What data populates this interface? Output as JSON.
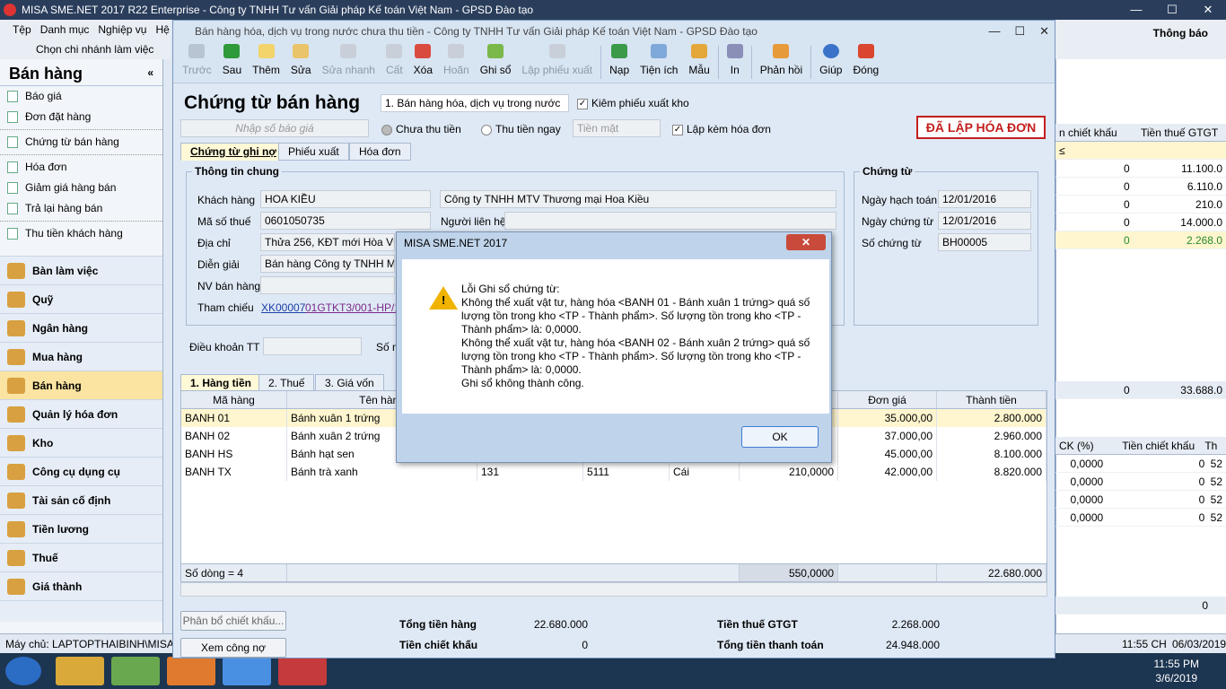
{
  "app": {
    "title": "MISA SME.NET 2017 R22 Enterprise - Công ty TNHH Tư vấn Giải pháp Kế toán Việt Nam - GPSD Đào tạo",
    "notify": "Thông báo"
  },
  "menu": {
    "items": [
      "Tệp",
      "Danh mục",
      "Nghiệp vụ",
      "Hệ"
    ],
    "branch": "Chọn chi nhánh làm việc"
  },
  "sidebar": {
    "title": "Bán hàng",
    "subs": [
      "Báo giá",
      "Đơn đặt hàng",
      "Chứng từ bán hàng",
      "Hóa đơn",
      "Giảm giá hàng bán",
      "Trả lại hàng bán",
      "Thu tiền khách hàng"
    ],
    "modules": [
      "Bàn làm việc",
      "Quỹ",
      "Ngân hàng",
      "Mua hàng",
      "Bán hàng",
      "Quản lý hóa đơn",
      "Kho",
      "Công cụ dụng cụ",
      "Tài sản cố định",
      "Tiền lương",
      "Thuế",
      "Giá thành"
    ]
  },
  "form": {
    "title": "Bán hàng hóa, dịch vụ trong nước chưa thu tiền - Công ty TNHH Tư vấn Giải pháp Kế toán Việt Nam - GPSD Đào tạo",
    "toolbar": [
      "Trước",
      "Sau",
      "Thêm",
      "Sửa",
      "Sửa nhanh",
      "Cất",
      "Xóa",
      "Hoãn",
      "Ghi sổ",
      "Lập phiếu xuất",
      "Nạp",
      "Tiện ích",
      "Mẫu",
      "In",
      "Phản hồi",
      "Giúp",
      "Đóng"
    ],
    "heading": "Chứng từ bán hàng",
    "type": "1. Bán hàng hóa, dịch vụ trong nước",
    "check_export": "Kiêm phiếu xuất kho",
    "quote_placeholder": "Nhập số báo giá",
    "unpaid": "Chưa thu tiền",
    "paid": "Thu tiền ngay",
    "cash": "Tiền mặt",
    "invoice_check": "Lập kèm hóa đơn",
    "badge": "ĐÃ LẬP HÓA ĐƠN",
    "tabs": [
      "Chứng từ ghi nợ",
      "Phiếu xuất",
      "Hóa đơn"
    ],
    "general": "Thông tin chung",
    "customer_lbl": "Khách hàng",
    "customer": "HOA KIỀU",
    "customer_name": "Công ty TNHH MTV Thương mại Hoa Kiều",
    "tax_lbl": "Mã số thuế",
    "tax": "0601050735",
    "contact_lbl": "Người liên hệ",
    "addr_lbl": "Địa chỉ",
    "addr": "Thửa 256, KĐT mới Hòa Vượng",
    "desc_lbl": "Diễn giải",
    "desc": "Bán hàng Công ty TNHH MTV",
    "staff_lbl": "NV bán hàng",
    "ref_lbl": "Tham chiếu",
    "ref1": "XK00007",
    "ref2": "01GTKT3/001-HP/15",
    "voucher": "Chứng từ",
    "acc_date_lbl": "Ngày hạch toán",
    "acc_date": "12/01/2016",
    "doc_date_lbl": "Ngày chứng từ",
    "doc_date": "12/01/2016",
    "doc_no_lbl": "Số chứng từ",
    "doc_no": "BH00005",
    "terms_lbl": "Điều khoản TT",
    "terms_no": "Số n",
    "gtabs": [
      "1. Hàng tiền",
      "2. Thuế",
      "3. Giá vốn"
    ],
    "cols": [
      "Mã hàng",
      "Tên hàng",
      "",
      "",
      "",
      "",
      "Đơn giá",
      "Thành tiền"
    ],
    "rows": [
      [
        "BANH 01",
        "Bánh xuân 1 trứng",
        "",
        "",
        "",
        "",
        "35.000,00",
        "2.800.000"
      ],
      [
        "BANH 02",
        "Bánh xuân 2 trứng",
        "",
        "",
        "",
        "",
        "37.000,00",
        "2.960.000"
      ],
      [
        "BANH HS",
        "Bánh hạt sen",
        "",
        "",
        "",
        "",
        "45.000,00",
        "8.100.000"
      ],
      [
        "BANH TX",
        "Bánh trà xanh",
        "131",
        "5111",
        "Cái",
        "210,0000",
        "42.000,00",
        "8.820.000"
      ]
    ],
    "footer_count": "Số dòng = 4",
    "footer_qty": "550,0000",
    "footer_total": "22.680.000",
    "alloc_btn": "Phân bổ chiết khấu...",
    "view_btn": "Xem công nợ",
    "t1_lbl": "Tổng tiền hàng",
    "t1": "22.680.000",
    "t2_lbl": "Tiền chiết khấu",
    "t2": "0",
    "t3_lbl": "Tiền thuế GTGT",
    "t3": "2.268.000",
    "t4_lbl": "Tổng tiền thanh toán",
    "t4": "24.948.000"
  },
  "right": {
    "h1": "n chiết khấu",
    "h2": "Tiền thuế GTGT",
    "filter": "≤",
    "rows": [
      [
        "0",
        "11.100.0"
      ],
      [
        "0",
        "6.110.0"
      ],
      [
        "0",
        "210.0"
      ],
      [
        "0",
        "14.000.0"
      ],
      [
        "0",
        "2.268.0"
      ]
    ],
    "sum1": "0",
    "sum2": "33.688.0",
    "h3": "CK (%)",
    "h4": "Tiền chiết khấu",
    "h5": "Th",
    "rows2": [
      [
        "0,0000",
        "0",
        "52"
      ],
      [
        "0,0000",
        "0",
        "52"
      ],
      [
        "0,0000",
        "0",
        "52"
      ],
      [
        "0,0000",
        "0",
        "52"
      ]
    ],
    "zero": "0"
  },
  "dialog": {
    "title": "MISA SME.NET 2017",
    "msg": "Lỗi Ghi sổ chứng từ:\nKhông thể xuất vật tư, hàng hóa <BANH 01 - Bánh xuân 1 trứng> quá số lượng tồn trong kho <TP - Thành phẩm>. Số lượng tồn trong kho <TP - Thành phẩm> là: 0,0000.\nKhông thể xuất vật tư, hàng hóa <BANH 02 - Bánh xuân 2 trứng> quá số lượng tồn trong kho <TP - Thành phẩm>. Số lượng tồn trong kho <TP - Thành phẩm> là: 0,0000.\nGhi sổ không thành công.",
    "ok": "OK",
    "close": "✕"
  },
  "status": {
    "host": "Máy chủ: LAPTOPTHAIBINH\\MISA",
    "time": "11:55 CH",
    "date": "06/03/2019"
  },
  "taskbar": {
    "time": "11:55 PM",
    "date": "3/6/2019"
  }
}
